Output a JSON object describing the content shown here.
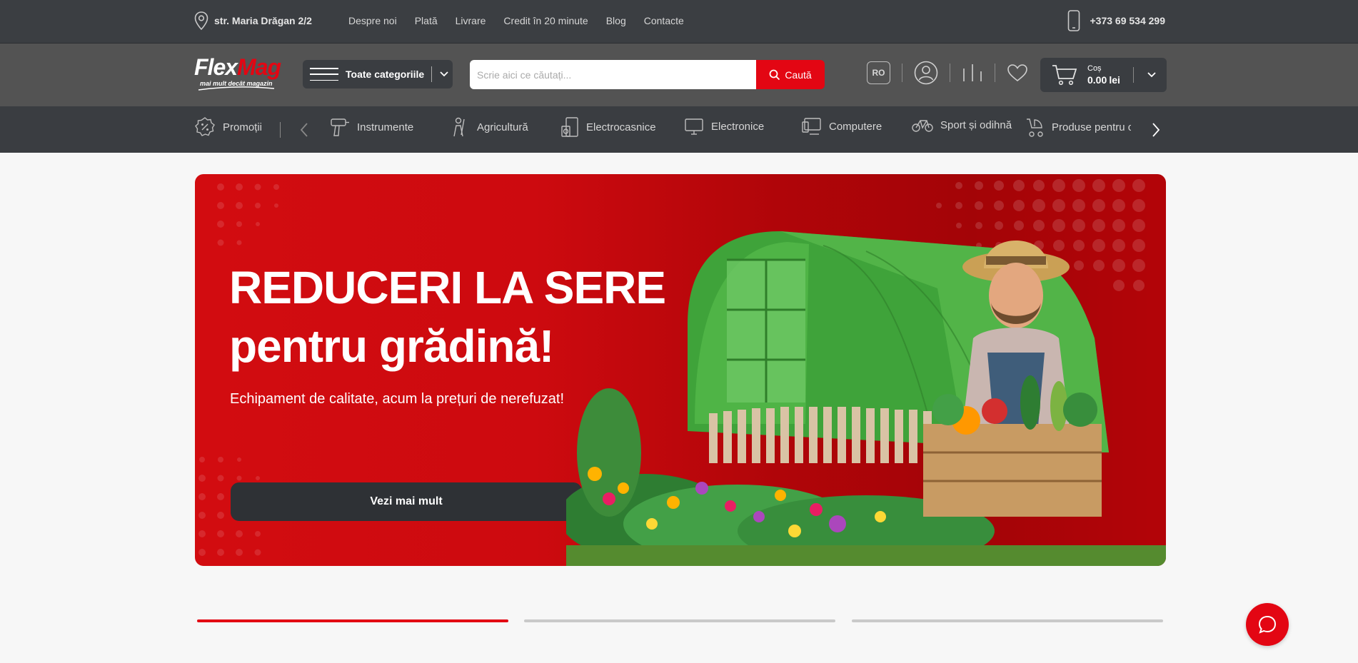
{
  "topbar": {
    "address": "str. Maria Drăgan 2/2",
    "links": [
      "Despre noi",
      "Plată",
      "Livrare",
      "Credit în 20 minute",
      "Blog",
      "Contacte"
    ],
    "phone": "+373 69 534 299"
  },
  "header": {
    "logo": {
      "word_a": "Flex",
      "word_b": "Mag",
      "tagline": "mai mult decât magazin"
    },
    "categories_label": "Toate categoriile",
    "search": {
      "placeholder": "Scrie aici ce căutați...",
      "button": "Caută"
    },
    "lang": "RO",
    "cart": {
      "label": "Coș",
      "total": "0.00",
      "currency": "lei"
    }
  },
  "nav": {
    "promo": "Promoții",
    "items": [
      "Instrumente",
      "Agricultură",
      "Electrocasnice",
      "Electronice",
      "Computere",
      "Sport și odihnă",
      "Produse pentru copii"
    ]
  },
  "banner": {
    "title_line1": "REDUCERI LA SERE",
    "title_line2": "pentru grădină!",
    "subtitle": "Echipament de calitate, acum la prețuri de nerefuzat!",
    "cta": "Vezi mai mult"
  },
  "slider": {
    "count": 3,
    "active": 1
  },
  "colors": {
    "brand_red": "#e30613",
    "dark": "#3a3d41",
    "header_gray": "#535353"
  }
}
